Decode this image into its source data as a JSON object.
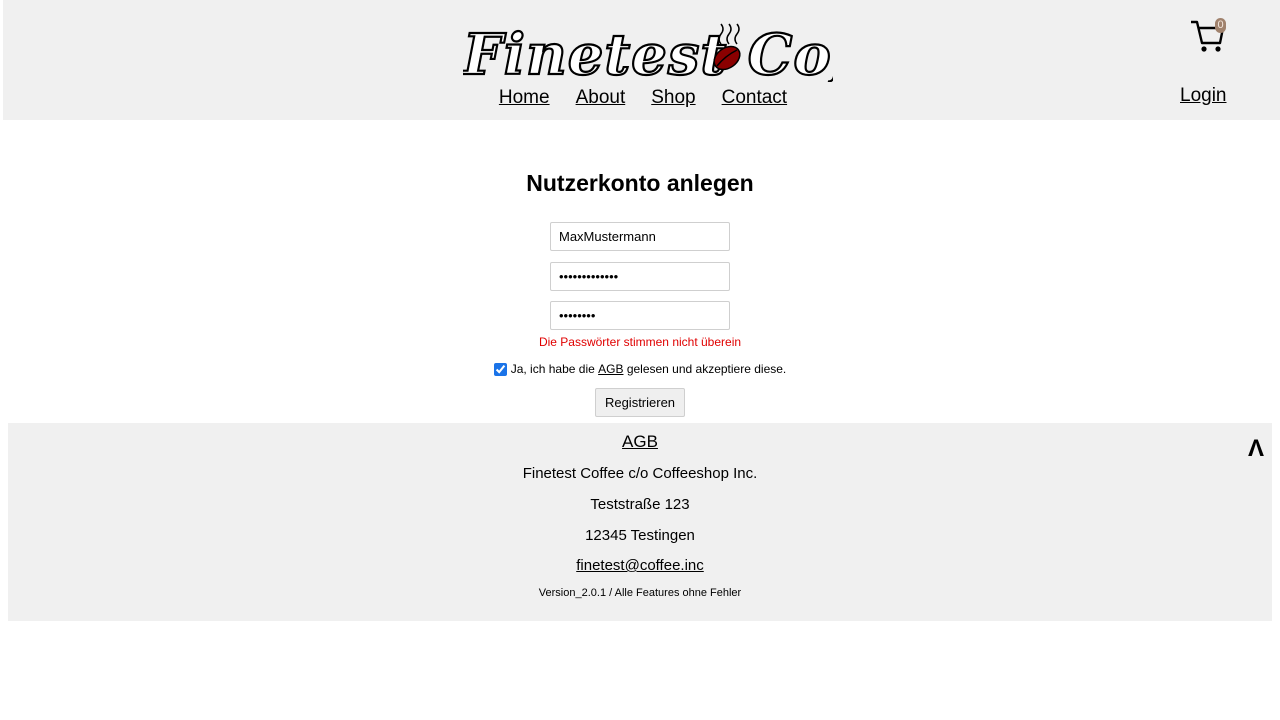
{
  "header": {
    "logo_text": "Finetest Coffee",
    "nav": [
      "Home",
      "About",
      "Shop",
      "Contact"
    ],
    "cart_count": "0",
    "login_label": "Login",
    "cart_icon": "shopping-cart-icon"
  },
  "form": {
    "title": "Nutzerkonto anlegen",
    "username_value": "MaxMustermann",
    "password_value": "•••••••••••••",
    "password_repeat_value": "••••••••",
    "error_text": "Die Passwörter stimmen nicht überein",
    "agb_prefix": "Ja, ich habe die",
    "agb_link": "AGB",
    "agb_suffix": "gelesen und akzeptiere diese.",
    "agb_checked": true,
    "register_label": "Registrieren"
  },
  "footer": {
    "agb_link": "AGB",
    "company": "Finetest Coffee c/o Coffeeshop Inc.",
    "street": "Teststraße 123",
    "city": "12345 Testingen",
    "email": "finetest@coffee.inc",
    "version": "Version_2.0.1 / Alle Features ohne Fehler",
    "to_top": "Λ"
  },
  "colors": {
    "header_bg": "#f0f0f0",
    "error": "#e00000",
    "coffee_bean": "#8b0000",
    "badge": "#a0826d"
  }
}
